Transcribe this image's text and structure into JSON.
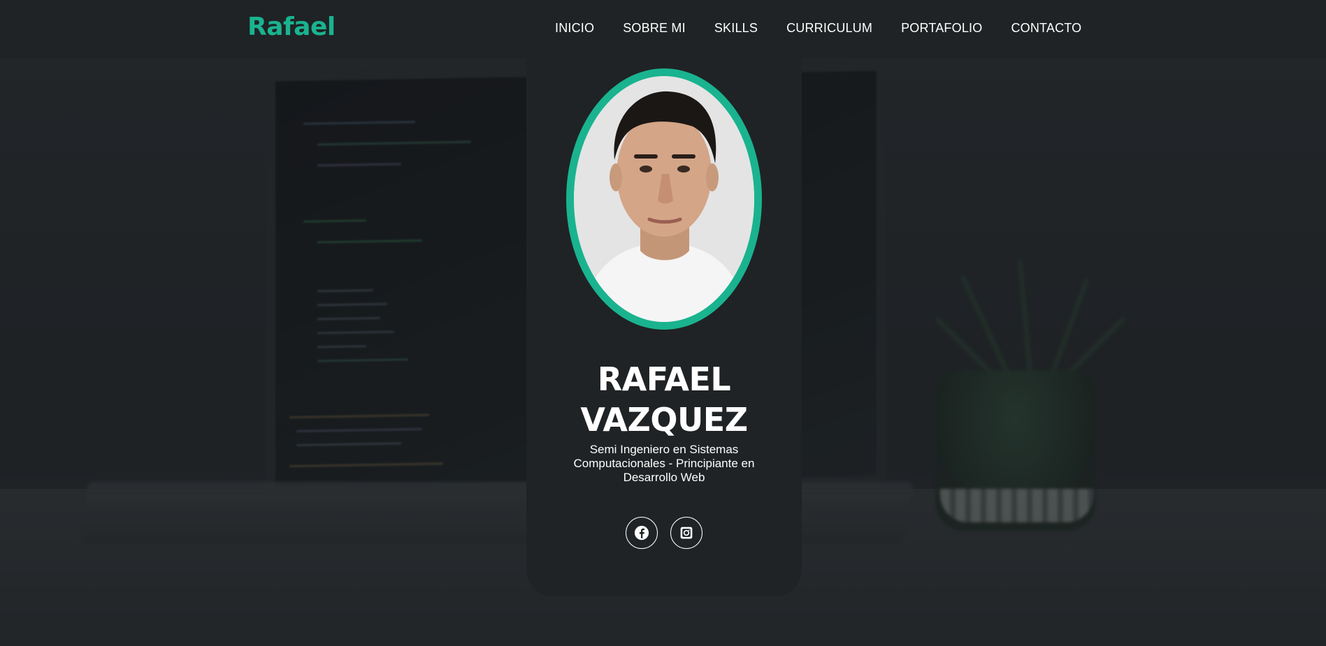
{
  "header": {
    "logo": "Rafael",
    "nav": [
      {
        "label": "INICIO"
      },
      {
        "label": "SOBRE MI"
      },
      {
        "label": "SKILLS"
      },
      {
        "label": "CURRICULUM"
      },
      {
        "label": "PORTAFOLIO"
      },
      {
        "label": "CONTACTO"
      }
    ]
  },
  "profile": {
    "name_line1": "RAFAEL",
    "name_line2": "VAZQUEZ",
    "description": "Semi Ingeniero en Sistemas Computacionales - Principiante en Desarrollo Web",
    "photo_icon": "profile-photo"
  },
  "socials": [
    {
      "icon": "facebook-icon"
    },
    {
      "icon": "instagram-icon"
    }
  ],
  "colors": {
    "accent": "#1ab38f",
    "header_bg": "#1f2325",
    "card_bg": "#1f2325",
    "text": "#ffffff"
  }
}
